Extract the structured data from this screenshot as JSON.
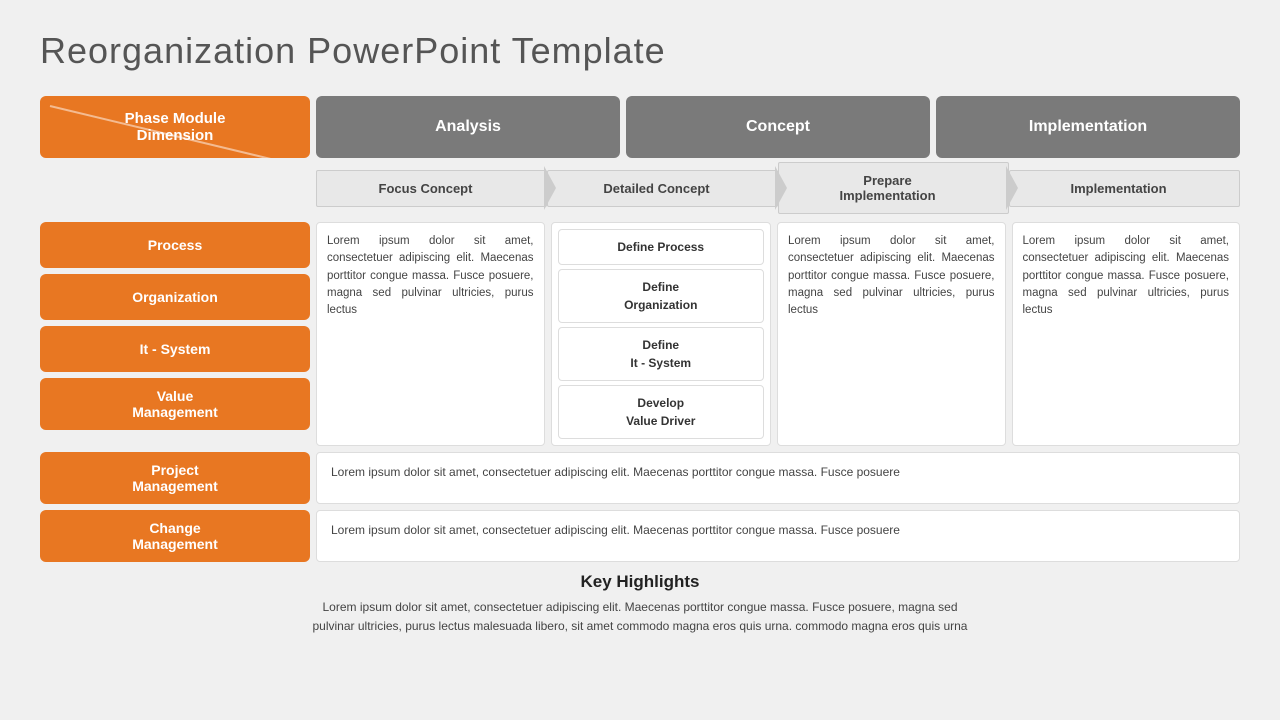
{
  "title": "Reorganization  PowerPoint  Template",
  "phase_module": {
    "label1": "Phase Module",
    "label2": "Dimension"
  },
  "phases": [
    {
      "label": "Analysis"
    },
    {
      "label": "Concept"
    },
    {
      "label": "Implementation"
    }
  ],
  "sub_phases": [
    {
      "label": "Focus Concept"
    },
    {
      "label": "Detailed Concept"
    },
    {
      "label": "Prepare\nImplementation"
    },
    {
      "label": "Implementation"
    }
  ],
  "left_labels": [
    {
      "label": "Process"
    },
    {
      "label": "Organization"
    },
    {
      "label": "It - System"
    },
    {
      "label": "Value\nManagement"
    }
  ],
  "lorem_short": "Lorem ipsum dolor sit amet, consectetuer adipiscing elit. Maecenas porttitor congue massa. Fusce posuere, magna sed pulvinar ultricies, purus lectus",
  "define_boxes": [
    {
      "label": "Define Process"
    },
    {
      "label": "Define\nOrganization"
    },
    {
      "label": "Define\nIt - System"
    },
    {
      "label": "Develop\nValue Driver"
    }
  ],
  "project_management": {
    "label": "Project\nManagement",
    "text": "Lorem ipsum dolor sit amet, consectetuer adipiscing elit. Maecenas porttitor congue massa. Fusce posuere"
  },
  "change_management": {
    "label": "Change\nManagement",
    "text": "Lorem ipsum dolor sit amet, consectetuer adipiscing elit. Maecenas porttitor congue massa. Fusce posuere"
  },
  "key_highlights": {
    "title": "Key Highlights",
    "text": "Lorem ipsum dolor sit amet, consectetuer adipiscing elit. Maecenas porttitor congue massa. Fusce posuere, magna sed\npulvinar ultricies, purus lectus malesuada libero, sit amet commodo magna eros quis urna.  commodo magna eros quis urna"
  },
  "colors": {
    "orange": "#e87722",
    "gray": "#7a7a7a",
    "light_gray": "#e8e8e8"
  }
}
